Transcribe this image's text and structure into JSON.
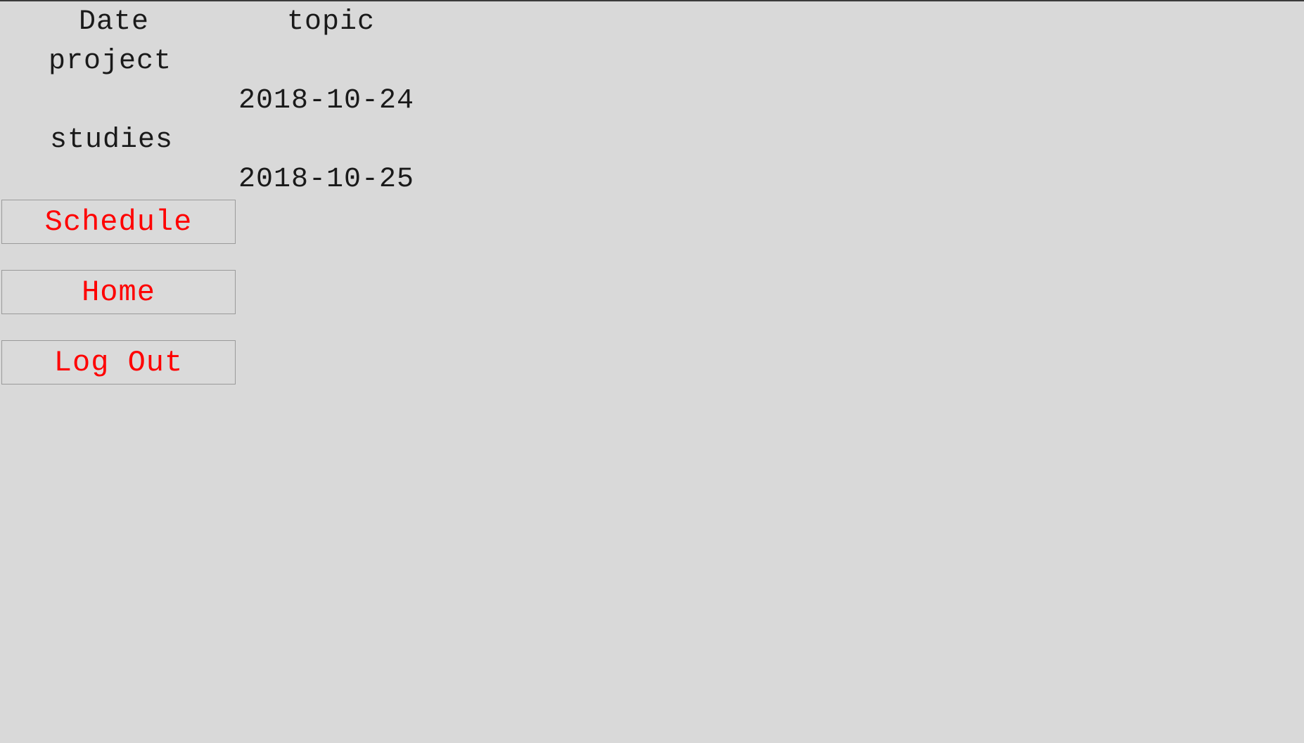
{
  "table": {
    "headers": {
      "date": "Date",
      "topic": "topic"
    },
    "rows": [
      {
        "topic": "project",
        "date": "2018-10-24"
      },
      {
        "topic": "studies",
        "date": "2018-10-25"
      }
    ]
  },
  "nav": {
    "schedule_label": "Schedule",
    "home_label": "Home",
    "logout_label": "Log Out"
  },
  "colors": {
    "background": "#d9d9d9",
    "button_text": "#ff0000",
    "text": "#1a1a1a"
  }
}
